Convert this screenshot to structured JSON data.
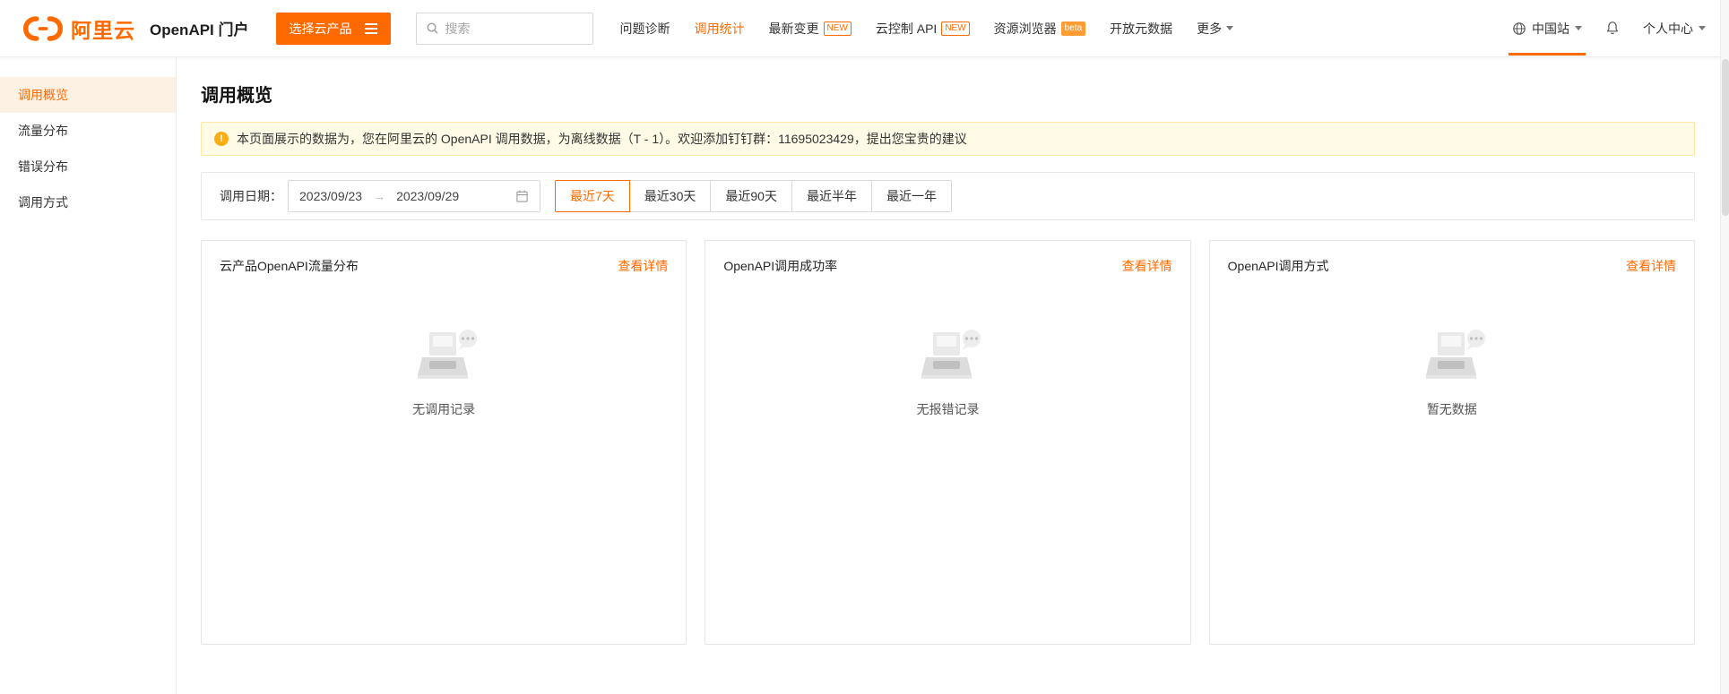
{
  "colors": {
    "accent": "#ff6a00",
    "warning": "#faad14"
  },
  "header": {
    "logo_text": "阿里云",
    "portal_title": "OpenAPI 门户",
    "product_button": "选择云产品",
    "search_placeholder": "搜索",
    "nav": [
      {
        "label": "问题诊断"
      },
      {
        "label": "调用统计",
        "active": true
      },
      {
        "label": "最新变更",
        "badge": "NEW"
      },
      {
        "label": "云控制 API",
        "badge": "NEW"
      },
      {
        "label": "资源浏览器",
        "badge": "beta"
      },
      {
        "label": "开放元数据"
      },
      {
        "label": "更多"
      }
    ],
    "region": "中国站",
    "account": "个人中心"
  },
  "sidebar": {
    "items": [
      {
        "label": "调用概览",
        "active": true
      },
      {
        "label": "流量分布"
      },
      {
        "label": "错误分布"
      },
      {
        "label": "调用方式"
      }
    ]
  },
  "main": {
    "page_title": "调用概览",
    "notice": "本页面展示的数据为，您在阿里云的 OpenAPI 调用数据，为离线数据（T - 1）。欢迎添加钉钉群：11695023429，提出您宝贵的建议",
    "filter": {
      "label": "调用日期：",
      "start_date": "2023/09/23",
      "arrow_separator": "→",
      "end_date": "2023/09/29",
      "ranges": [
        "最近7天",
        "最近30天",
        "最近90天",
        "最近半年",
        "最近一年"
      ],
      "active_range": "最近7天"
    },
    "cards": [
      {
        "title": "云产品OpenAPI流量分布",
        "link": "查看详情",
        "empty_text": "无调用记录"
      },
      {
        "title": "OpenAPI调用成功率",
        "link": "查看详情",
        "empty_text": "无报错记录"
      },
      {
        "title": "OpenAPI调用方式",
        "link": "查看详情",
        "empty_text": "暂无数据"
      }
    ]
  }
}
